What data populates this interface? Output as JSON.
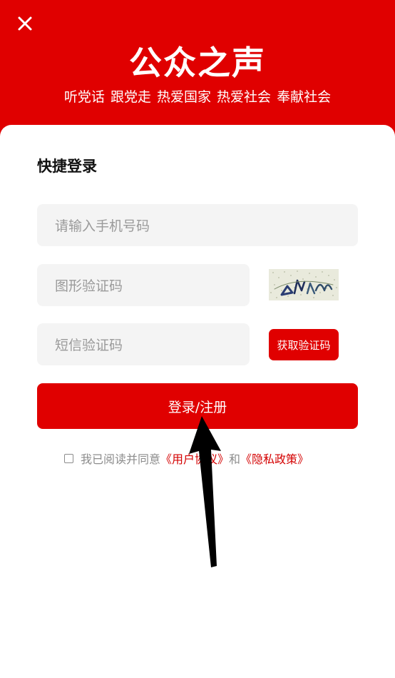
{
  "header": {
    "title": "公众之声",
    "slogan": "听党话 跟党走 热爱国家 热爱社会 奉献社会"
  },
  "form": {
    "section_title": "快捷登录",
    "phone_placeholder": "请输入手机号码",
    "captcha_placeholder": "图形验证码",
    "sms_placeholder": "短信验证码",
    "get_code_label": "获取验证码",
    "submit_label": "登录/注册"
  },
  "agreement": {
    "prefix": "我已阅读并同意",
    "user_agreement": "《用户协议》",
    "conjunction": "和",
    "privacy_policy": "《隐私政策》",
    "checked": false
  },
  "colors": {
    "brand_red": "#e00000",
    "link_red": "#d40000",
    "placeholder_gray": "#9a9a9a",
    "field_bg": "#f4f4f4"
  },
  "icons": {
    "close": "close-icon",
    "checkbox": "checkbox-icon",
    "annotation_arrow": "arrow-icon"
  }
}
